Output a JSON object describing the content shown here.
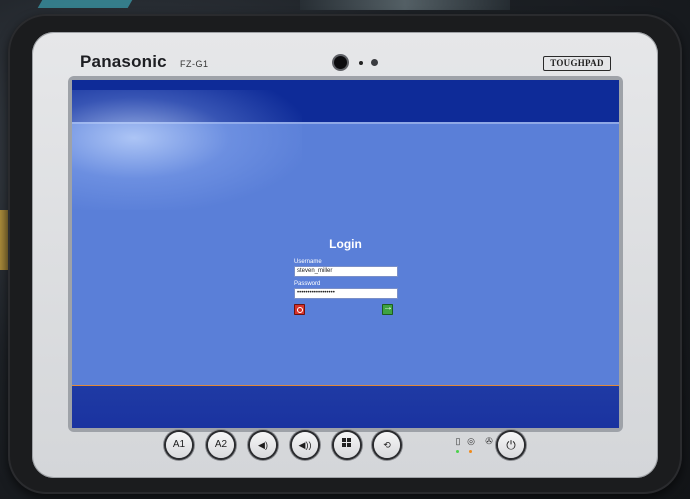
{
  "device": {
    "brand": "Panasonic",
    "model": "FZ-G1",
    "badge": "TOUGHPAD"
  },
  "login": {
    "title": "Login",
    "username_label": "Username",
    "username_value": "steven_miller",
    "password_label": "Password",
    "password_value": "••••••••••••••••••"
  },
  "hardware_buttons": {
    "a1": "A1",
    "a2": "A2",
    "vol_down": "◀︎)",
    "vol_up": "◀︎))",
    "rotate": "⟲"
  },
  "icons": {
    "shutdown": "power-icon",
    "submit": "arrow-right-icon",
    "windows": "windows-icon",
    "power": "power-icon"
  },
  "colors": {
    "screen_bg": "#5a7fd8",
    "bar": "#0e2b98",
    "shutdown": "#d8322a",
    "go": "#3ea341"
  }
}
